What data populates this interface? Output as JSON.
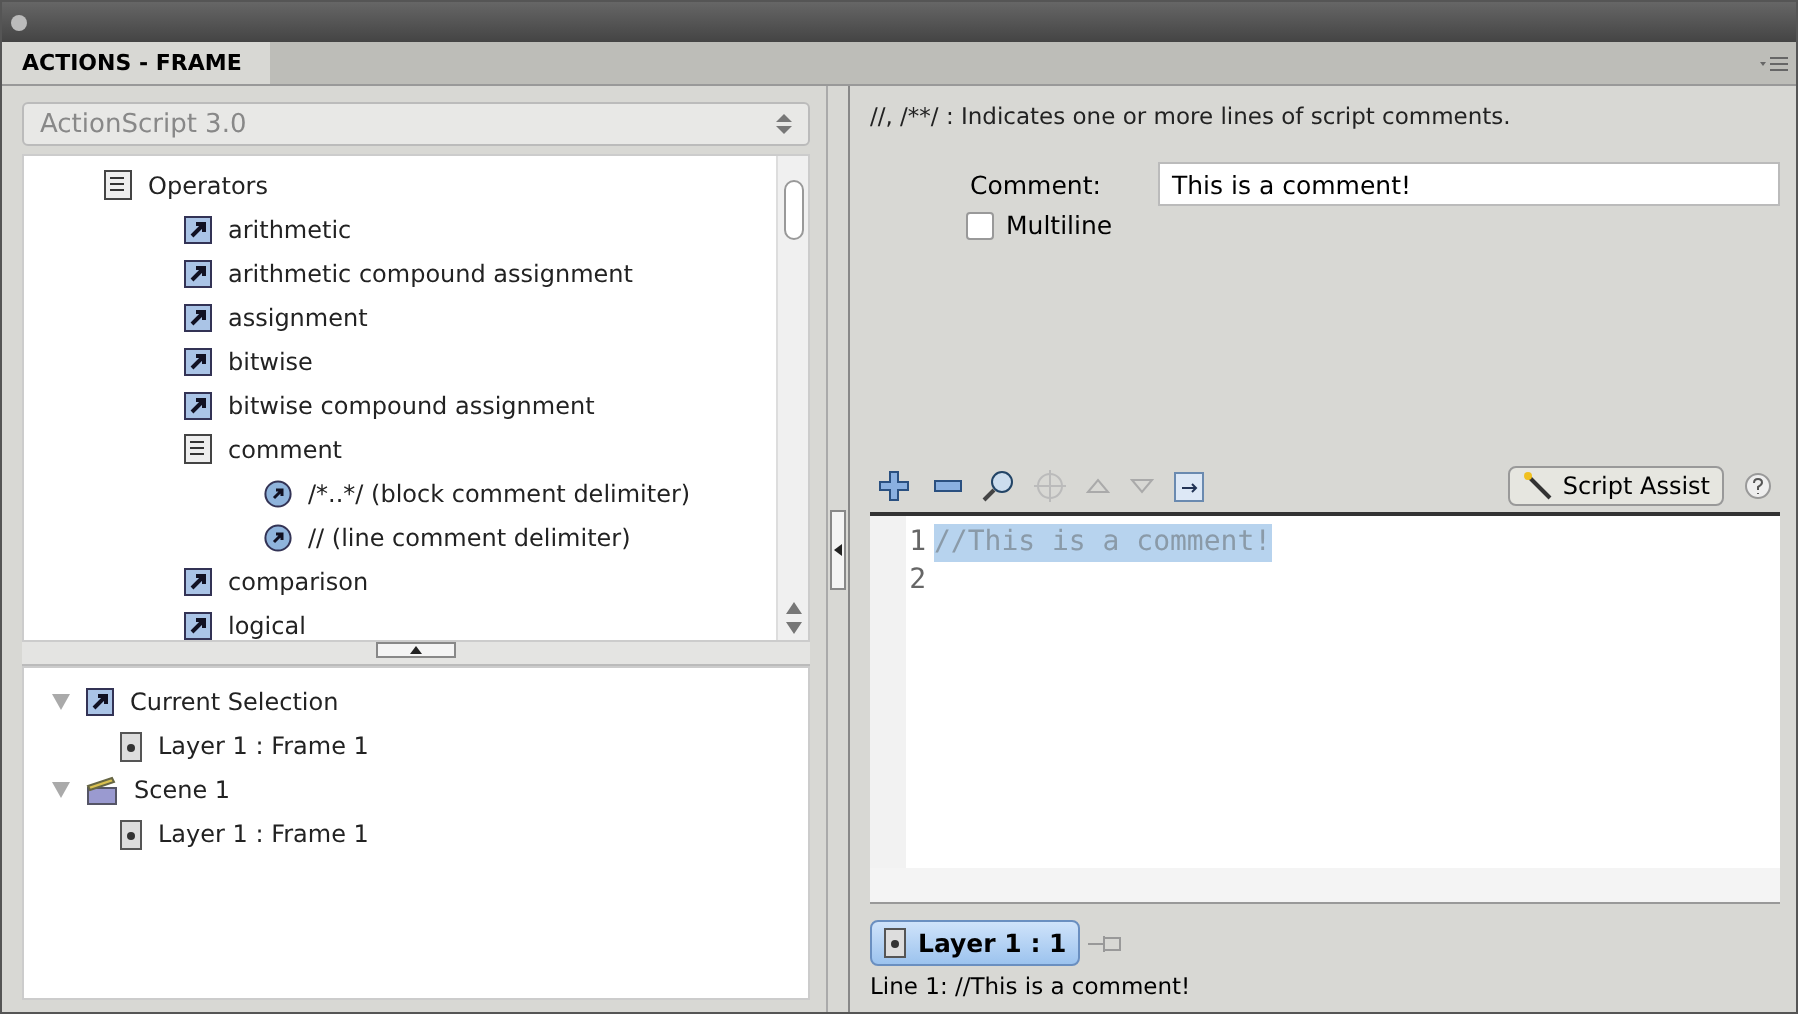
{
  "panel": {
    "tab": "ACTIONS - FRAME"
  },
  "language_select": {
    "value": "ActionScript 3.0"
  },
  "toolbox": [
    {
      "label": "Operators",
      "kind": "book",
      "children": [
        {
          "label": "arithmetic",
          "kind": "action"
        },
        {
          "label": "arithmetic compound assignment",
          "kind": "action"
        },
        {
          "label": "assignment",
          "kind": "action"
        },
        {
          "label": "bitwise",
          "kind": "action"
        },
        {
          "label": "bitwise compound assignment",
          "kind": "action"
        },
        {
          "label": "comment",
          "kind": "book",
          "children": [
            {
              "label": "/*..*/ (block comment delimiter)",
              "kind": "operator"
            },
            {
              "label": "// (line comment delimiter)",
              "kind": "operator"
            }
          ]
        },
        {
          "label": "comparison",
          "kind": "action"
        },
        {
          "label": "logical",
          "kind": "action"
        }
      ]
    }
  ],
  "navigator": [
    {
      "label": "Current Selection",
      "kind": "action",
      "expanded": true,
      "children": [
        {
          "label": "Layer 1 : Frame 1",
          "kind": "frame"
        }
      ]
    },
    {
      "label": "Scene 1",
      "kind": "scene",
      "expanded": true,
      "children": [
        {
          "label": "Layer 1 : Frame 1",
          "kind": "frame"
        }
      ]
    }
  ],
  "description": "//, /**/ : Indicates one or more lines of script comments.",
  "comment_field": {
    "label": "Comment:",
    "value": "This is a comment!"
  },
  "multiline": {
    "label": "Multiline",
    "checked": false
  },
  "script_assist": {
    "label": "Script Assist",
    "on": true
  },
  "editor": {
    "lines": [
      {
        "number": "1",
        "text": "//This is a comment!",
        "selected": true
      },
      {
        "number": "2",
        "selected": false
      }
    ]
  },
  "script_tabs": [
    {
      "label": "Layer 1 : 1",
      "selected": true
    }
  ],
  "status_line": "Line 1: //This is a comment!"
}
